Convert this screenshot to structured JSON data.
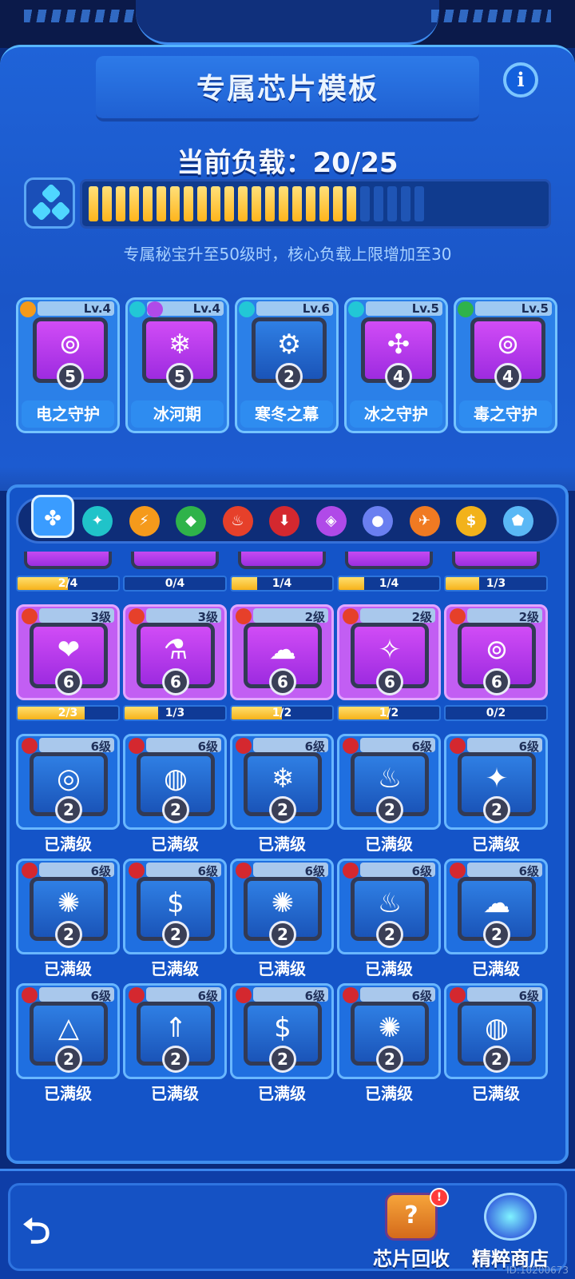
{
  "header": {
    "title": "专属芯片模板",
    "info_label": "i",
    "load_text": "当前负载：20/25",
    "load_current": 20,
    "load_max": 25,
    "hint": "专属秘宝升至50级时，核心负载上限增加至30"
  },
  "equipped": [
    {
      "name": "电之守护",
      "level": "Lv.4",
      "count": "5",
      "glyph": "⊚",
      "symbols": [
        "electric-icon"
      ]
    },
    {
      "name": "冰河期",
      "level": "Lv.4",
      "count": "5",
      "glyph": "❄",
      "symbols": [
        "ice-icon",
        "poison-purple-icon"
      ]
    },
    {
      "name": "寒冬之幕",
      "level": "Lv.6",
      "count": "2",
      "glyph": "⚙",
      "symbols": [
        "ice-icon"
      ]
    },
    {
      "name": "冰之守护",
      "level": "Lv.5",
      "count": "4",
      "glyph": "✣",
      "symbols": [
        "ice-icon"
      ]
    },
    {
      "name": "毒之守护",
      "level": "Lv.5",
      "count": "4",
      "glyph": "⊚",
      "symbols": [
        "poison-icon"
      ]
    }
  ],
  "tabs": [
    "all",
    "ice",
    "electric",
    "poison",
    "fire",
    "blood",
    "arcane",
    "frost-orb",
    "rocket",
    "coin",
    "shield"
  ],
  "row0_progress": [
    {
      "text": "2/4",
      "fraction": 0.5
    },
    {
      "text": "0/4",
      "fraction": 0
    },
    {
      "text": "1/4",
      "fraction": 0.25
    },
    {
      "text": "1/4",
      "fraction": 0.25
    },
    {
      "text": "1/3",
      "fraction": 0.33
    }
  ],
  "row1": [
    {
      "level": "3级",
      "count": "6",
      "glyph": "❤",
      "progress": "2/3",
      "fraction": 0.67
    },
    {
      "level": "3级",
      "count": "6",
      "glyph": "⚗",
      "progress": "1/3",
      "fraction": 0.33
    },
    {
      "level": "2级",
      "count": "6",
      "glyph": "☁",
      "progress": "1/2",
      "fraction": 0.5
    },
    {
      "level": "2级",
      "count": "6",
      "glyph": "✧",
      "progress": "1/2",
      "fraction": 0.5
    },
    {
      "level": "2级",
      "count": "6",
      "glyph": "⊚",
      "progress": "0/2",
      "fraction": 0
    }
  ],
  "maxed_rows": [
    [
      {
        "level": "6级",
        "count": "2",
        "glyph": "◎",
        "status": "已满级"
      },
      {
        "level": "6级",
        "count": "2",
        "glyph": "◍",
        "status": "已满级"
      },
      {
        "level": "6级",
        "count": "2",
        "glyph": "❄",
        "status": "已满级"
      },
      {
        "level": "6级",
        "count": "2",
        "glyph": "♨",
        "status": "已满级"
      },
      {
        "level": "6级",
        "count": "2",
        "glyph": "✦",
        "status": "已满级"
      }
    ],
    [
      {
        "level": "6级",
        "count": "2",
        "glyph": "✺",
        "status": "已满级"
      },
      {
        "level": "6级",
        "count": "2",
        "glyph": "$",
        "status": "已满级"
      },
      {
        "level": "6级",
        "count": "2",
        "glyph": "✺",
        "status": "已满级"
      },
      {
        "level": "6级",
        "count": "2",
        "glyph": "♨",
        "status": "已满级"
      },
      {
        "level": "6级",
        "count": "2",
        "glyph": "☁",
        "status": "已满级"
      }
    ],
    [
      {
        "level": "6级",
        "count": "2",
        "glyph": "△",
        "status": "已满级"
      },
      {
        "level": "6级",
        "count": "2",
        "glyph": "⇑",
        "status": "已满级"
      },
      {
        "level": "6级",
        "count": "2",
        "glyph": "$",
        "status": "已满级"
      },
      {
        "level": "6级",
        "count": "2",
        "glyph": "✺",
        "status": "已满级"
      },
      {
        "level": "6级",
        "count": "2",
        "glyph": "◍",
        "status": "已满级"
      }
    ]
  ],
  "bottom": {
    "recycle_label": "芯片回收",
    "shop_label": "精粹商店",
    "alert": "!",
    "id_text": "ID:10200673"
  }
}
